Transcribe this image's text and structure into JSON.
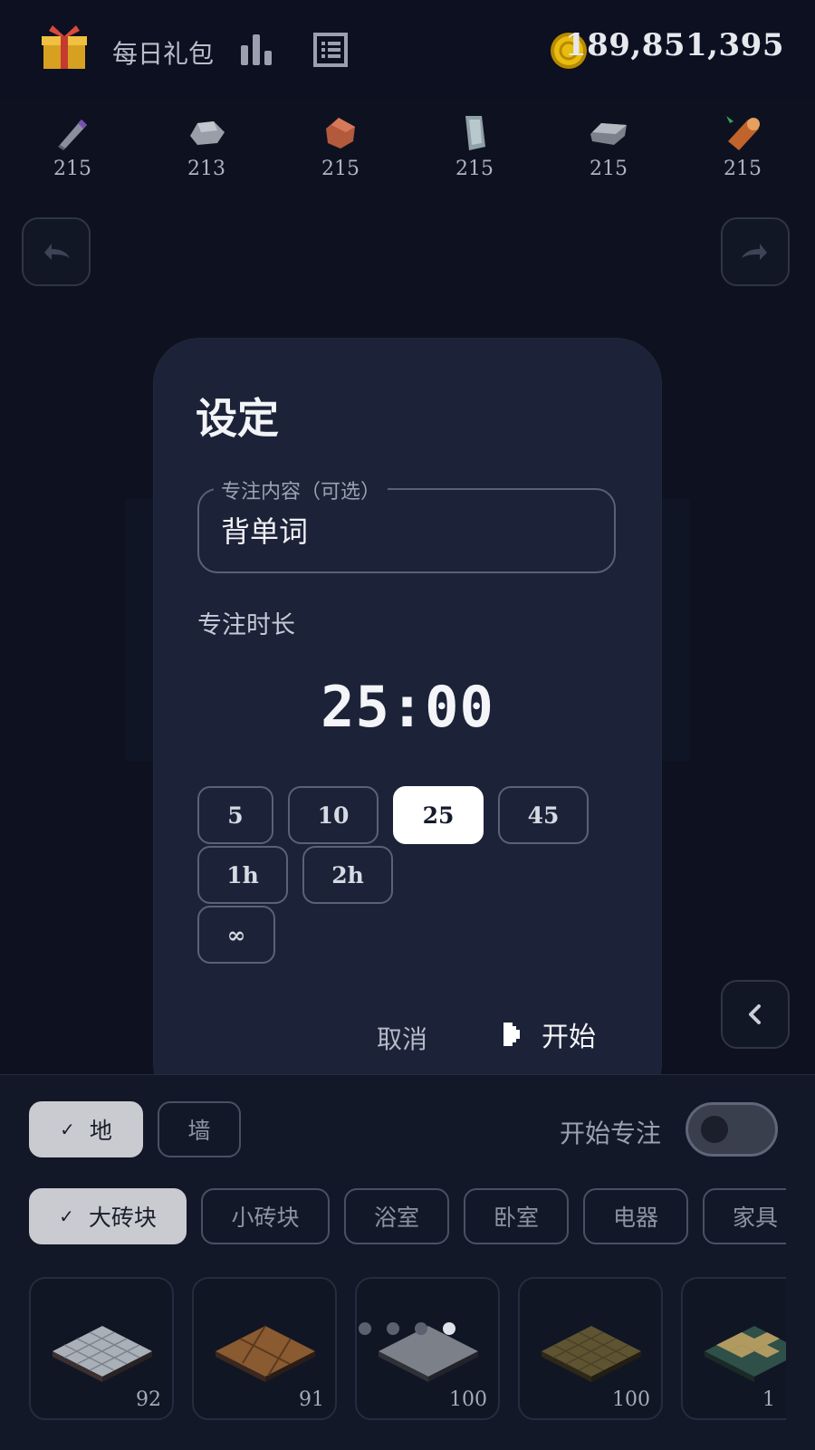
{
  "header": {
    "gift_label": "每日礼包",
    "coins": "189,851,395"
  },
  "resources": [
    {
      "icon": "pipe-icon",
      "count": "215"
    },
    {
      "icon": "stone-icon",
      "count": "213"
    },
    {
      "icon": "leather-icon",
      "count": "215"
    },
    {
      "icon": "glass-icon",
      "count": "215"
    },
    {
      "icon": "iron-ingot-icon",
      "count": "215"
    },
    {
      "icon": "wood-log-icon",
      "count": "215"
    }
  ],
  "dialog": {
    "title": "设定",
    "focus_content_label": "专注内容（可选）",
    "focus_content_value": "背单词",
    "duration_label": "专注时长",
    "timer": "25:00",
    "options": [
      "5",
      "10",
      "25",
      "45",
      "1h",
      "2h",
      "∞"
    ],
    "selected_option": "25",
    "cancel_label": "取消",
    "start_label": "开始"
  },
  "bottom": {
    "layer_tabs": [
      {
        "label": "地",
        "active": true
      },
      {
        "label": "墙",
        "active": false
      }
    ],
    "focus_toggle_label": "开始专注",
    "focus_toggle_on": false,
    "categories": [
      {
        "label": "大砖块",
        "active": true
      },
      {
        "label": "小砖块",
        "active": false
      },
      {
        "label": "浴室",
        "active": false
      },
      {
        "label": "卧室",
        "active": false
      },
      {
        "label": "电器",
        "active": false
      },
      {
        "label": "家具",
        "active": false
      }
    ],
    "tiles": [
      {
        "count": "92"
      },
      {
        "count": "91"
      },
      {
        "count": "100"
      },
      {
        "count": "100"
      },
      {
        "count": "1"
      }
    ],
    "page_dots": 4,
    "active_dot": 4
  },
  "colors": {
    "background": "#0e1220",
    "dialog": "#1c2237",
    "coin": "#e0b400",
    "selected_chip": "#ffffff"
  }
}
